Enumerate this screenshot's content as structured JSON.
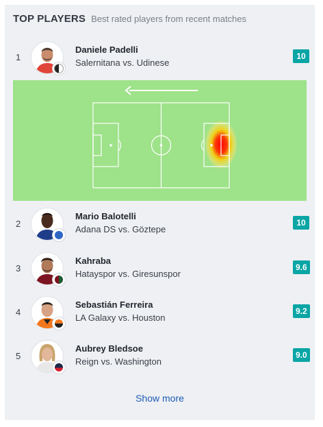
{
  "header": {
    "title": "TOP PLAYERS",
    "subtitle": "Best rated players from recent matches"
  },
  "players": [
    {
      "rank": "1",
      "name": "Daniele Padelli",
      "match": "Salernitana vs. Udinese",
      "rating": "10",
      "team_color": "#ffffff",
      "team_color_2": "#222222"
    },
    {
      "rank": "2",
      "name": "Mario Balotelli",
      "match": "Adana DS vs. Göztepe",
      "rating": "10",
      "team_color": "#2f66c4",
      "team_color_2": "#ffffff"
    },
    {
      "rank": "3",
      "name": "Kahraba",
      "match": "Hatayspor vs. Giresunspor",
      "rating": "9.6",
      "team_color": "#7d1421",
      "team_color_2": "#1f5b33"
    },
    {
      "rank": "4",
      "name": "Sebastián Ferreira",
      "match": "LA Galaxy vs. Houston",
      "rating": "9.2",
      "team_color": "#f3771c",
      "team_color_2": "#222222"
    },
    {
      "rank": "5",
      "name": "Aubrey Bledsoe",
      "match": "Reign vs. Washington",
      "rating": "9.0",
      "team_color": "#1b2a4a",
      "team_color_2": "#d22030"
    }
  ],
  "heatmap": {
    "direction_icon": "arrow-left-icon",
    "pitch_color": "#9ee28a",
    "line_color": "#ffffff",
    "hot_color": "#ff0000",
    "warm_color": "#ffdd00"
  },
  "footer": {
    "show_more_label": "Show more"
  },
  "colors": {
    "rating_bg": "#0aa5a5",
    "link": "#1d5bb4",
    "card_bg": "#eef0f3"
  }
}
